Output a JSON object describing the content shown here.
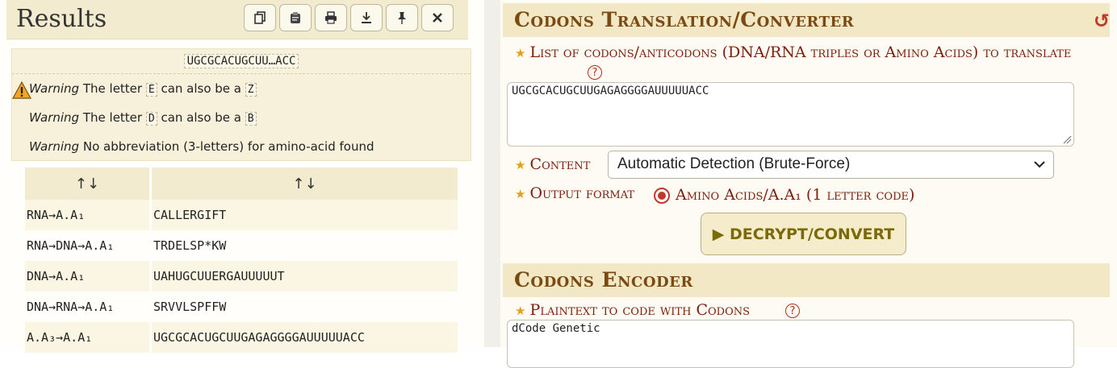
{
  "results": {
    "title": "Results",
    "toolbar_icons": [
      "copy-icon",
      "clipboard-icon",
      "print-icon",
      "download-icon",
      "pin-icon",
      "close-icon"
    ],
    "input_preview": "UGCGCACUGCUU…ACC",
    "warnings": [
      {
        "label": "Warning",
        "pre": "The letter ",
        "chip1": "E",
        "mid": " can also be a ",
        "chip2": "Z"
      },
      {
        "label": "Warning",
        "pre": "The letter ",
        "chip1": "D",
        "mid": " can also be a ",
        "chip2": "B"
      },
      {
        "label": "Warning",
        "text": "No abbreviation (3-letters) for amino-acid found"
      }
    ],
    "table": {
      "headers": [
        "↑↓",
        "↑↓"
      ],
      "rows": [
        [
          "RNA→A.A₁",
          "CALLERGIFT"
        ],
        [
          "RNA→DNA→A.A₁",
          "TRDELSP*KW"
        ],
        [
          "DNA→A.A₁",
          "UAHUGCUUERGAUUUUUT"
        ],
        [
          "DNA→RNA→A.A₁",
          "SRVVLSPFFW"
        ],
        [
          "A.A₃→A.A₁",
          "UGCGCACUGCUUGAGAGGGGAUUUUUACC"
        ]
      ]
    }
  },
  "translator": {
    "title": "Codons Translation/Converter",
    "list_label": "List of codons/anticodons (DNA/RNA triples or Amino Acids) to translate",
    "help": "?",
    "input_value": "UGCGCACUGCUUGAGAGGGGAUUUUUACC",
    "content_label": "Content",
    "content_selected": "Automatic Detection (Brute-Force)",
    "output_label": "Output format",
    "output_option": "Amino Acids/A.A₁ (1 letter code)",
    "button_label": "▶ DECRYPT/CONVERT"
  },
  "encoder": {
    "title": "Codons Encoder",
    "plaintext_label": "Plaintext to code with Codons",
    "help": "?",
    "plaintext_value": "dCode Genetic"
  },
  "colors": {
    "title_brown": "#7a4a12",
    "label_red": "#7d1f0a",
    "star_gold": "#e0a21b",
    "button_text": "#7a6a0a"
  }
}
